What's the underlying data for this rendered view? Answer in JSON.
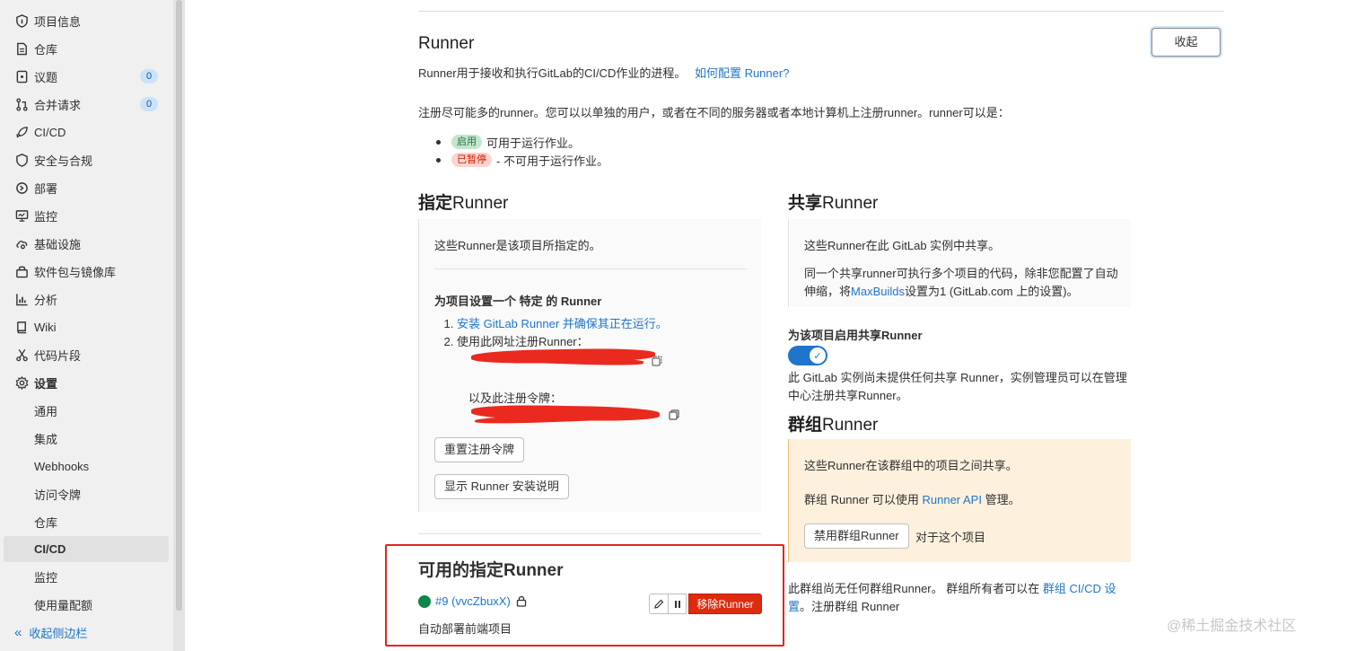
{
  "sidebar": {
    "items": [
      {
        "label": "项目信息",
        "icon": "info-icon"
      },
      {
        "label": "仓库",
        "icon": "document-icon"
      },
      {
        "label": "议题",
        "icon": "issues-icon",
        "badge": "0"
      },
      {
        "label": "合并请求",
        "icon": "merge-request-icon",
        "badge": "0"
      },
      {
        "label": "CI/CD",
        "icon": "rocket-icon"
      },
      {
        "label": "安全与合规",
        "icon": "shield-icon"
      },
      {
        "label": "部署",
        "icon": "deploy-icon"
      },
      {
        "label": "监控",
        "icon": "monitor-icon"
      },
      {
        "label": "基础设施",
        "icon": "cloud-gear-icon"
      },
      {
        "label": "软件包与镜像库",
        "icon": "package-icon"
      },
      {
        "label": "分析",
        "icon": "chart-icon"
      },
      {
        "label": "Wiki",
        "icon": "book-icon"
      },
      {
        "label": "代码片段",
        "icon": "scissors-icon"
      },
      {
        "label": "设置",
        "icon": "gear-icon"
      }
    ],
    "sub_items": [
      "通用",
      "集成",
      "Webhooks",
      "访问令牌",
      "仓库",
      "CI/CD",
      "监控",
      "使用量配额"
    ],
    "collapse_label": "收起侧边栏"
  },
  "runner": {
    "title": "Runner",
    "description": "Runner用于接收和执行GitLab的CI/CD作业的进程。",
    "help_link": "如何配置 Runner?",
    "collapse_button": "收起",
    "register_text": "注册尽可能多的runner。您可以以单独的用户，或者在不同的服务器或者本地计算机上注册runner。runner可以是：",
    "status_active_tag": "启用",
    "status_active_text": "可用于运行作业。",
    "status_paused_tag": "已暂停",
    "status_paused_text": "- 不可用于运行作业。"
  },
  "specific": {
    "title_bold": "指定",
    "title_light": "Runner",
    "intro": "这些Runner是该项目所指定的。",
    "setup_heading": "为项目设置一个 特定 的 Runner",
    "step1_link": "安装 GitLab Runner 并确保其正在运行。",
    "step2": "使用此网址注册Runner：",
    "token_label": "以及此注册令牌：",
    "reset_button": "重置注册令牌",
    "show_install_button": "显示 Runner 安装说明"
  },
  "available": {
    "title": "可用的指定Runner",
    "runner_name": "#9 (vvcZbuxX)",
    "runner_description": "自动部署前端项目",
    "remove_button": "移除Runner",
    "status_color": "#108548"
  },
  "shared": {
    "title_bold": "共享",
    "title_light": "Runner",
    "intro": "这些Runner在此 GitLab 实例中共享。",
    "desc_prefix": "同一个共享runner可执行多个项目的代码，除非您配置了自动伸缩，将",
    "desc_link": "MaxBuilds",
    "desc_suffix": "设置为1 (GitLab.com 上的设置)。",
    "enable_label": "为该项目启用共享Runner",
    "note": "此 GitLab 实例尚未提供任何共享 Runner，实例管理员可以在管理中心注册共享Runner。"
  },
  "group": {
    "title_bold": "群组",
    "title_light": "Runner",
    "intro": "这些Runner在该群组中的项目之间共享。",
    "api_prefix": "群组 Runner 可以使用 ",
    "api_link": "Runner API",
    "api_suffix": " 管理。",
    "disable_button": "禁用群组Runner",
    "disable_suffix": "对于这个项目",
    "note_prefix": "此群组尚无任何群组Runner。 群组所有者可以在 ",
    "note_link": "群组 CI/CD 设置",
    "note_suffix": "。注册群组 Runner"
  },
  "watermark": "@稀土掘金技术社区",
  "colors": {
    "accent": "#1f75cb",
    "danger": "#dd2b0e",
    "highlight_border": "#e4241e"
  }
}
